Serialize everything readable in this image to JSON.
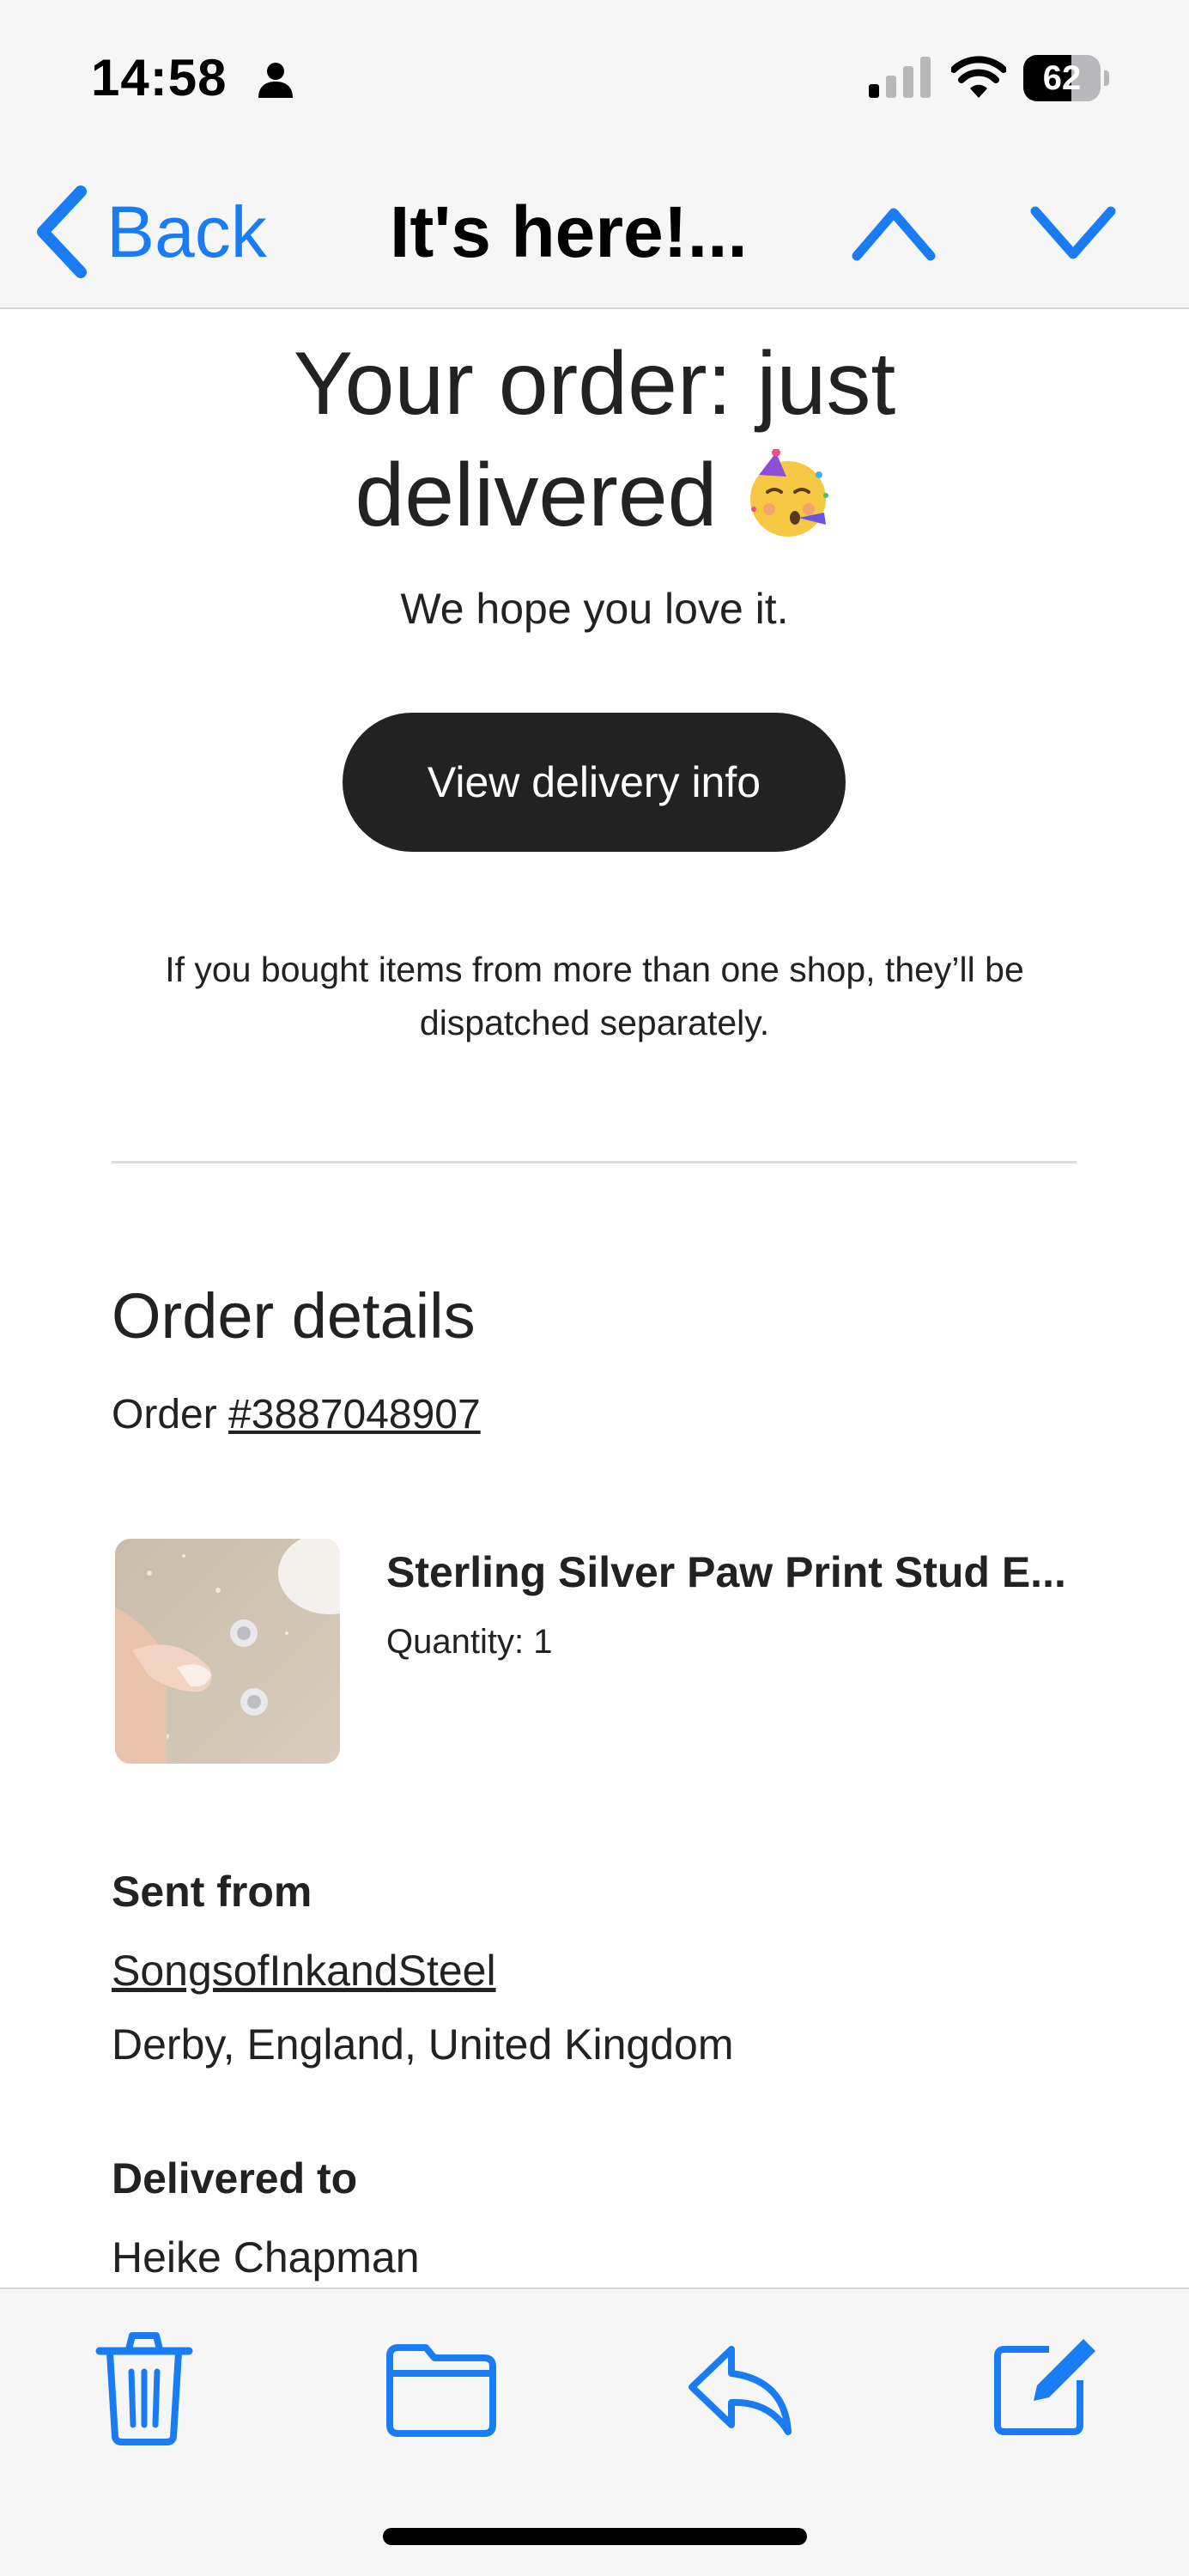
{
  "status_bar": {
    "time": "14:58",
    "battery": "62",
    "battery_level": 0.62,
    "icons": [
      "person-icon",
      "cellular-signal-icon",
      "wifi-icon",
      "battery-icon"
    ]
  },
  "nav": {
    "back_label": "Back",
    "title": "It's here!...",
    "icons": [
      "chevron-left-icon",
      "chevron-up-icon",
      "chevron-down-icon"
    ]
  },
  "email": {
    "headline_line1": "Your order: just",
    "headline_line2": "delivered",
    "headline_emoji": "party-face-icon",
    "subhead": "We hope you love it.",
    "button_label": "View delivery info",
    "notice": "If you bought items from more than one shop, they’ll be dispatched separately.",
    "order_details_title": "Order details",
    "order_prefix": "Order",
    "order_number": "#3887048907",
    "product": {
      "title": "Sterling Silver Paw Print Stud E...",
      "quantity": "Quantity: 1",
      "image": "paw-print-earrings-photo"
    },
    "sent_from_title": "Sent from",
    "shop_name": "SongsofInkandSteel",
    "shop_location": "Derby, England, United Kingdom",
    "delivered_to_title": "Delivered to",
    "recipient": "Heike Chapman"
  },
  "toolbar": {
    "icons": [
      "trash-icon",
      "folder-icon",
      "reply-icon",
      "compose-icon"
    ]
  },
  "colors": {
    "accent": "#1a7cf2",
    "bar_background": "#f6f6f7",
    "button_dark": "#222222",
    "text": "#222222"
  }
}
